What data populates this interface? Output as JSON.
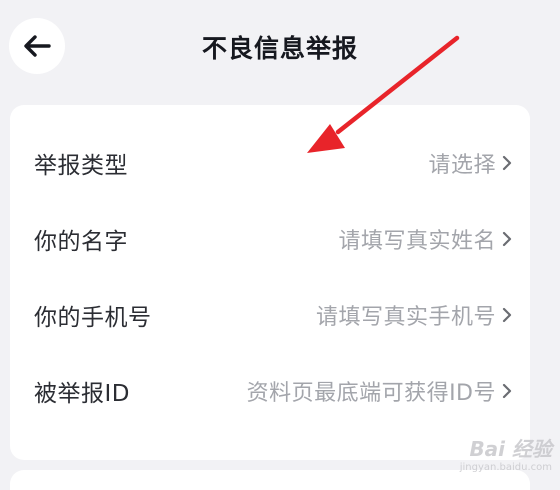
{
  "header": {
    "title": "不良信息举报",
    "back_icon": "arrow-left-icon"
  },
  "form": {
    "rows": [
      {
        "label": "举报类型",
        "value": "请选择",
        "icon": "chevron-right-icon"
      },
      {
        "label": "你的名字",
        "value": "请填写真实姓名",
        "icon": "chevron-right-icon"
      },
      {
        "label": "你的手机号",
        "value": "请填写真实手机号",
        "icon": "chevron-right-icon"
      },
      {
        "label": "被举报ID",
        "value": "资料页最底端可获得ID号",
        "icon": "chevron-right-icon"
      }
    ]
  },
  "annotation": {
    "icon": "red-arrow-icon",
    "color": "#e8242a"
  },
  "watermark": {
    "main": "Bai 经验",
    "sub": "jingyan.baidu.com"
  },
  "colors": {
    "background": "#f2f2f5",
    "card": "#ffffff",
    "label": "#2b2d33",
    "placeholder": "#a3a5ab"
  }
}
